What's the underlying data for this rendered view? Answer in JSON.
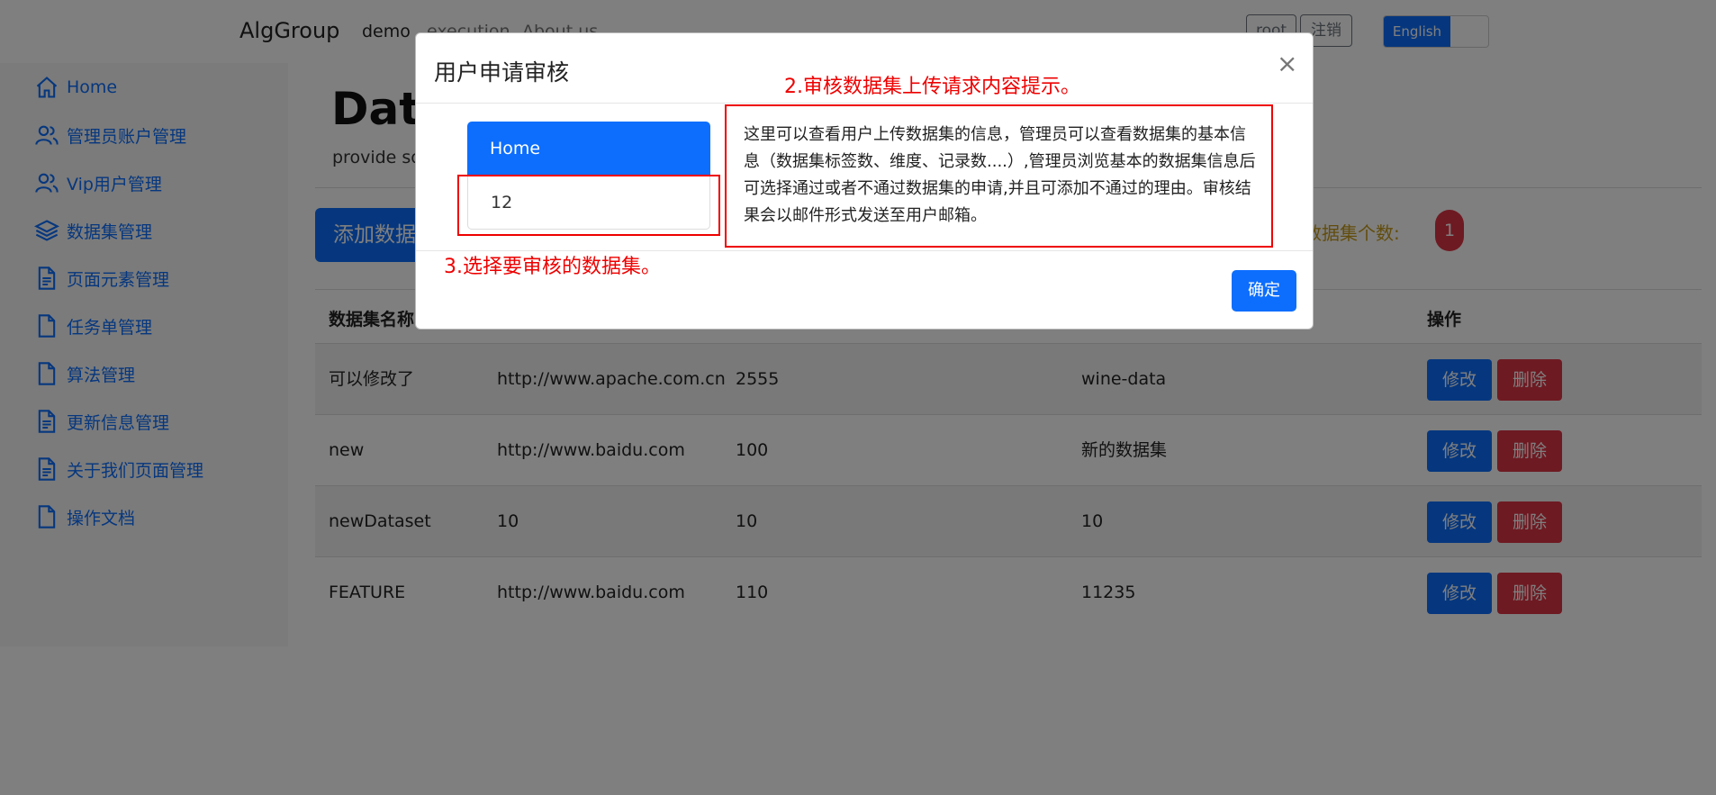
{
  "navbar": {
    "brand": "AlgGroup",
    "links": [
      "demo",
      "execution",
      "About us"
    ],
    "user_button": "root",
    "logout_button": "注销",
    "language_label": "English"
  },
  "sidebar": {
    "items": [
      {
        "label": "Home",
        "icon": "home-icon"
      },
      {
        "label": "管理员账户管理",
        "icon": "users-icon"
      },
      {
        "label": "Vip用户管理",
        "icon": "users-icon"
      },
      {
        "label": "数据集管理",
        "icon": "layers-icon"
      },
      {
        "label": "页面元素管理",
        "icon": "document-text-icon"
      },
      {
        "label": "任务单管理",
        "icon": "document-icon"
      },
      {
        "label": "算法管理",
        "icon": "document-icon"
      },
      {
        "label": "更新信息管理",
        "icon": "document-text-icon"
      },
      {
        "label": "关于我们页面管理",
        "icon": "document-text-icon"
      },
      {
        "label": "操作文档",
        "icon": "document-icon"
      }
    ]
  },
  "main": {
    "title": "Data",
    "subtitle": "provide so",
    "add_button": "添加数据",
    "count_label": "数据集个数:",
    "count_value": "1"
  },
  "table": {
    "headers": [
      "数据集名称",
      "操作"
    ],
    "rows": [
      {
        "name": "可以修改了",
        "url": "http://www.apache.com.cn",
        "size": "2555",
        "desc": "wine-data"
      },
      {
        "name": "new",
        "url": "http://www.baidu.com",
        "size": "100",
        "desc": "新的数据集"
      },
      {
        "name": "newDataset",
        "url": "10",
        "size": "10",
        "desc": "10"
      },
      {
        "name": "FEATURE",
        "url": "http://www.baidu.com",
        "size": "110",
        "desc": "11235"
      }
    ],
    "edit_label": "修改",
    "delete_label": "删除"
  },
  "modal": {
    "title": "用户申请审核",
    "close_symbol": "×",
    "list_active": "Home",
    "list_item": "12",
    "info_text": "这里可以查看用户上传数据集的信息，管理员可以查看数据集的基本信息（数据集标签数、维度、记录数....）,管理员浏览基本的数据集信息后可选择通过或者不通过数据集的申请,并且可添加不通过的理由。审核结果会以邮件形式发送至用户邮箱。",
    "confirm_button": "确定"
  },
  "annotations": {
    "note_2": "2.审核数据集上传请求内容提示。",
    "note_3": "3.选择要审核的数据集。"
  },
  "colors": {
    "primary": "#0d6efd",
    "danger": "#dc3545",
    "annotation": "#e00000",
    "count_label": "#c59a1a"
  }
}
